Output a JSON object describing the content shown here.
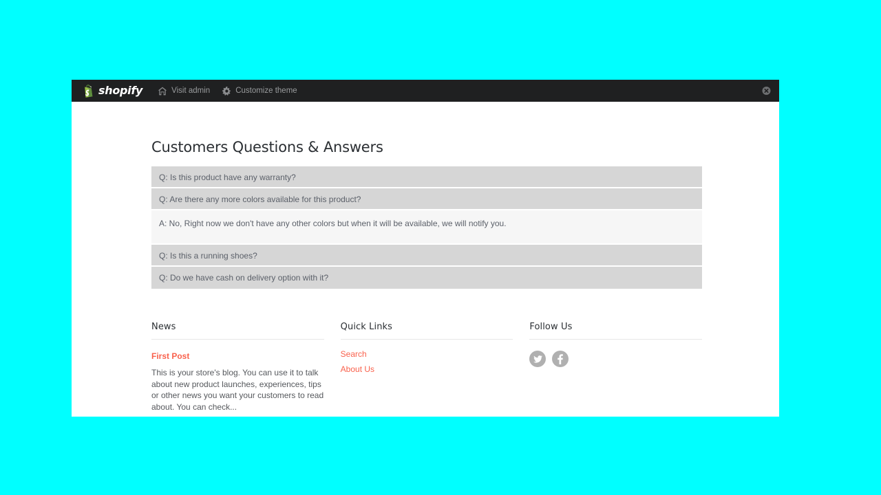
{
  "theme": {
    "background_color": "#00FFFF",
    "admin_bar_color": "#1f2021",
    "accent_color": "#f9614c",
    "question_row_color": "#d6d6d6",
    "answer_row_color": "#f6f6f6",
    "social_icon_color": "#b0b0b0"
  },
  "admin_bar": {
    "logo_text": "shopify",
    "logo_icon": "shopping-bag-icon",
    "links": [
      {
        "label": "Visit admin",
        "icon": "home-icon"
      },
      {
        "label": "Customize theme",
        "icon": "gear-icon"
      }
    ],
    "close_icon": "close-circle-icon"
  },
  "qa_section": {
    "title": "Customers Questions & Answers",
    "rows": [
      {
        "type": "question",
        "text": "Q: Is this product have any warranty?"
      },
      {
        "type": "question",
        "text": "Q: Are there any more colors available for this product?"
      },
      {
        "type": "answer",
        "text": "A: No, Right now we don't have any other colors but when it will be available, we will notify you."
      },
      {
        "type": "question",
        "text": "Q: Is this a running shoes?"
      },
      {
        "type": "question",
        "text": "Q: Do we have cash on delivery option with it?"
      }
    ]
  },
  "footer": {
    "news": {
      "heading": "News",
      "post_title": "First Post",
      "excerpt": "This is your store's blog. You can use it to talk about new product launches, experiences, tips or other news you want your customers to read about. You can check..."
    },
    "quick_links": {
      "heading": "Quick Links",
      "links": [
        {
          "label": "Search"
        },
        {
          "label": "About Us"
        }
      ]
    },
    "follow_us": {
      "heading": "Follow Us",
      "socials": [
        {
          "name": "twitter-icon"
        },
        {
          "name": "facebook-icon"
        }
      ]
    }
  }
}
